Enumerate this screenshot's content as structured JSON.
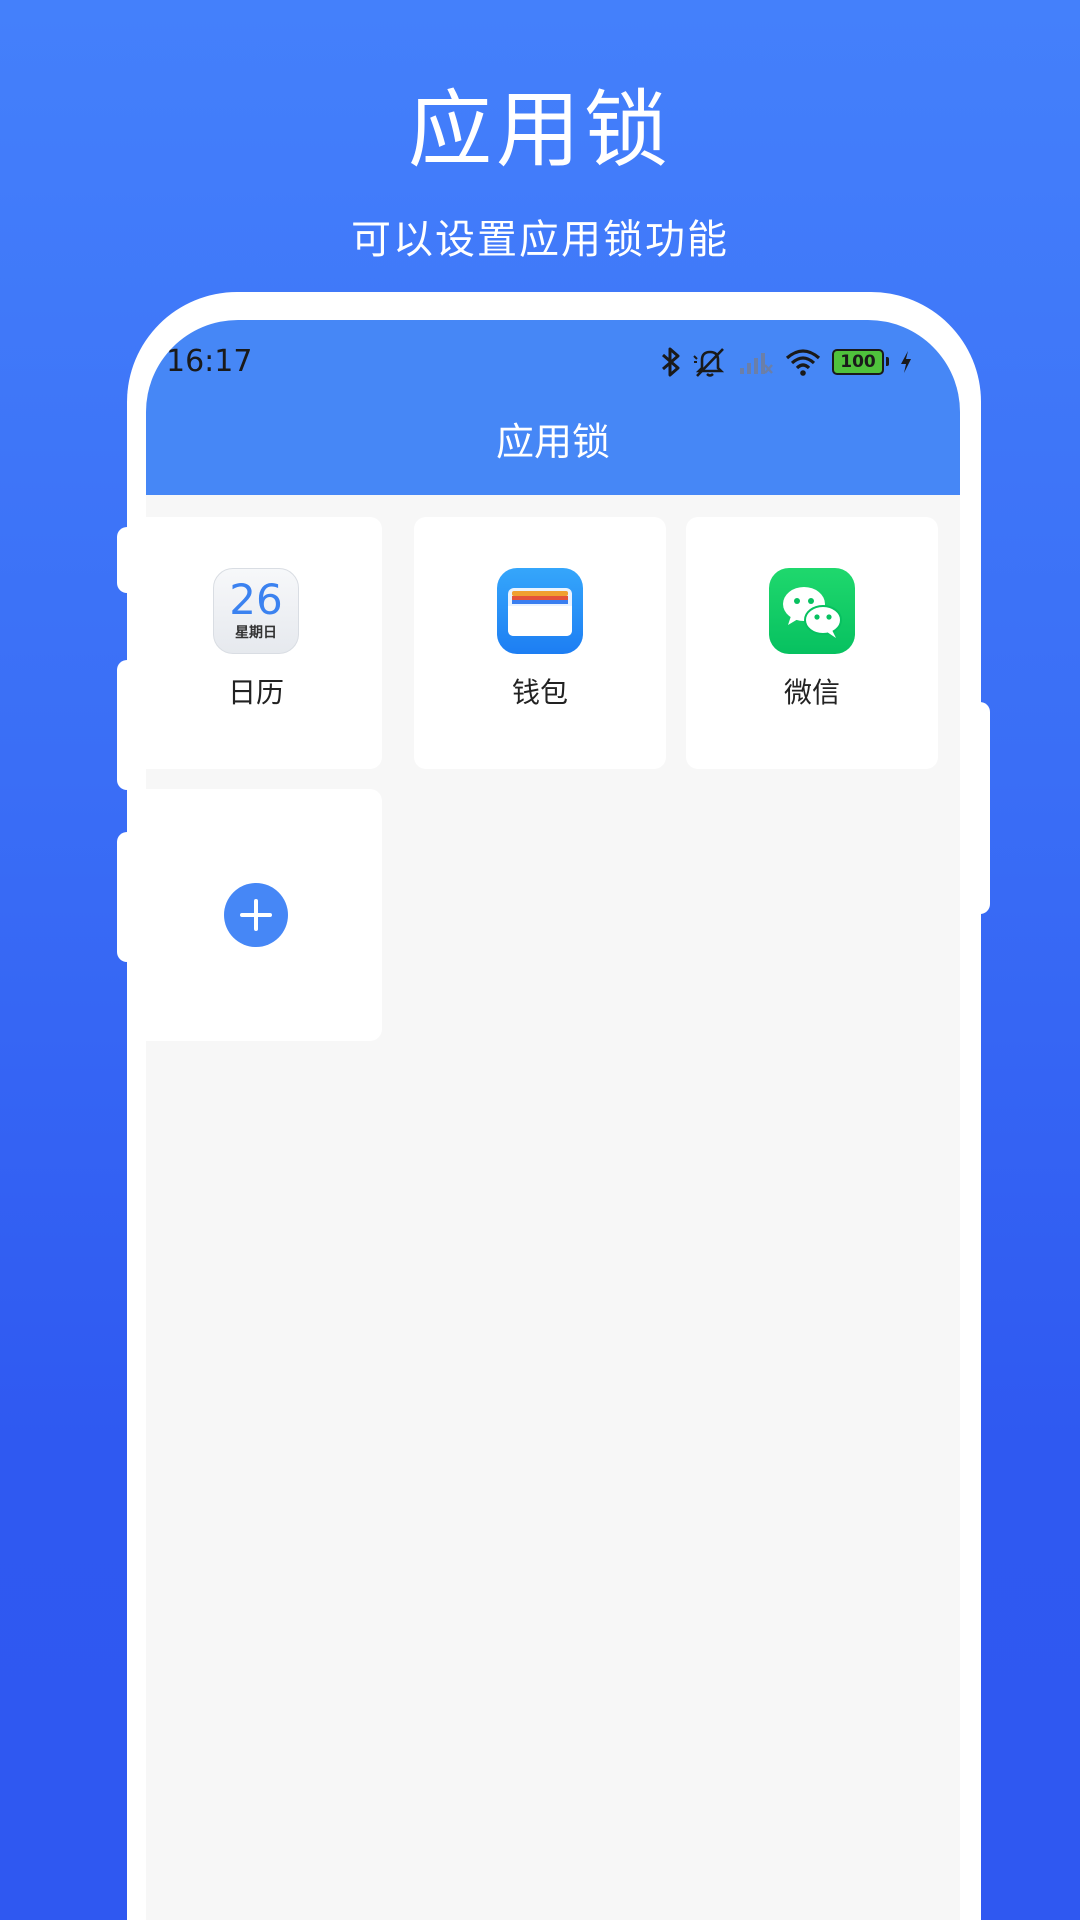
{
  "hero": {
    "title": "应用锁",
    "subtitle": "可以设置应用锁功能"
  },
  "status_bar": {
    "time": "16:17",
    "icons": [
      "bluetooth-icon",
      "mute-icon",
      "signal-icon",
      "wifi-icon",
      "battery-icon",
      "charging-icon"
    ],
    "battery_level": "100"
  },
  "app_bar": {
    "title": "应用锁"
  },
  "apps": [
    {
      "name": "日历",
      "icon": "calendar-icon",
      "icon_date": "26",
      "icon_weekday": "星期日"
    },
    {
      "name": "钱包",
      "icon": "wallet-icon"
    },
    {
      "name": "微信",
      "icon": "wechat-icon"
    }
  ],
  "add_button": {
    "icon": "plus-icon"
  },
  "colors": {
    "background": "#3a6ef6",
    "accent": "#4687f6",
    "screen_bg": "#f7f7f7"
  }
}
